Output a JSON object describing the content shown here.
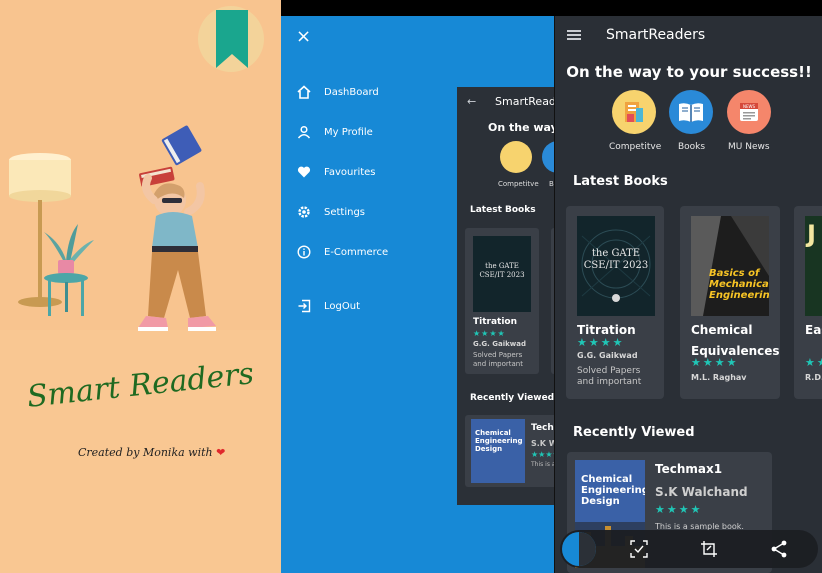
{
  "splash": {
    "title": "Smart Readers",
    "credit": "Created by Monika with",
    "heart": "❤"
  },
  "drawer": {
    "close": "×",
    "items": [
      {
        "label": "DashBoard",
        "icon": "home-icon"
      },
      {
        "label": "My Profile",
        "icon": "person-icon"
      },
      {
        "label": "Favourites",
        "icon": "heart-icon"
      },
      {
        "label": "Settings",
        "icon": "gear-icon"
      },
      {
        "label": "E-Commerce",
        "icon": "info-icon"
      },
      {
        "label": "LogOut",
        "icon": "logout-icon"
      }
    ]
  },
  "preview": {
    "back": "←",
    "title": "SmartReaders",
    "tagline": "On the way to your success!!",
    "cat_label_0": "Competitve",
    "cat_label_1": "B",
    "latest": "Latest Books",
    "book_cover_text": "the GATE CSE/IT 2023",
    "book_title": "Titration",
    "book_author": "G.G. Gaikwad",
    "book_desc": "Solved Papers and important",
    "recent": "Recently Viewed",
    "rv_cover": "Chemical Engineering Design",
    "rv_title": "Tech",
    "rv_author": "S.K W",
    "rv_desc": "This is a"
  },
  "app": {
    "title": "SmartReaders",
    "tagline": "On the way to your success!!",
    "categories": [
      {
        "label": "Competitve",
        "color": "#f7d36e"
      },
      {
        "label": "Books",
        "color": "#2a8ad8"
      },
      {
        "label": "MU News",
        "color": "#f5866b"
      }
    ],
    "latest_title": "Latest Books",
    "books": [
      {
        "title": "Titration",
        "author": "G.G. Gaikwad",
        "desc": "Solved Papers and important",
        "cover_text": "the GATE CSE/IT 2023"
      },
      {
        "title": "Chemical Equivalences",
        "author": "M.L. Raghav",
        "desc": "",
        "cover_text": "Basics of Mechanical Engineering"
      },
      {
        "title": "Eas Sol",
        "author": "R.D.",
        "desc": "",
        "cover_text": "J"
      }
    ],
    "stars": "★★★★",
    "recent_title": "Recently Viewed",
    "recent": {
      "cover_text": "Chemical Engineering Design",
      "title": "Techmax1",
      "author": "S.K Walchand",
      "stars": "★★★★",
      "desc": "This is a sample book."
    }
  },
  "toolbar": {
    "icons": [
      "scan-icon",
      "crop-icon",
      "share-icon"
    ]
  }
}
